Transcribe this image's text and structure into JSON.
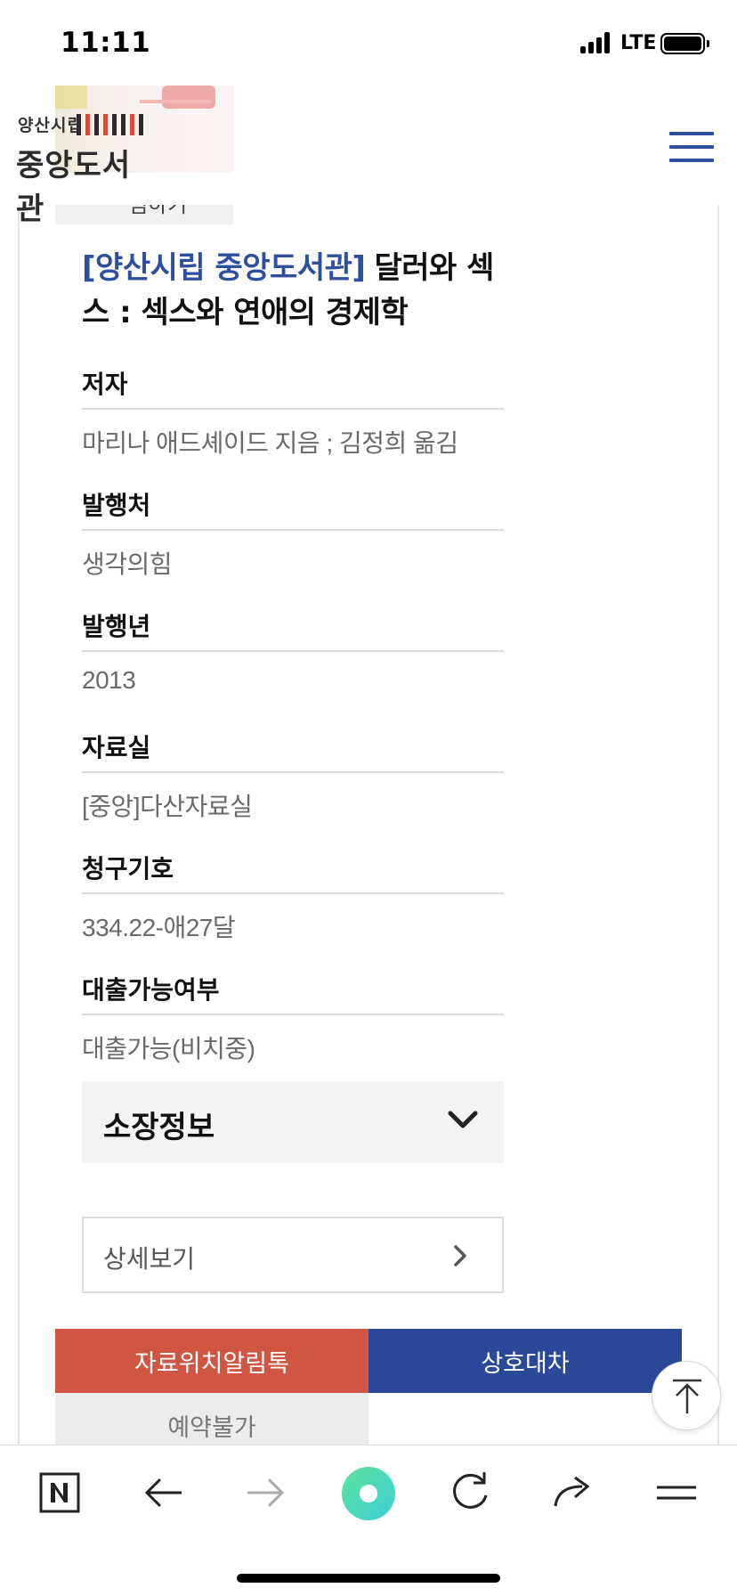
{
  "status_bar": {
    "time": "11:11",
    "network": "LTE"
  },
  "header": {
    "logo_line1": "양산시립",
    "logo_line2": "중앙도서관"
  },
  "wishlist": {
    "label": "찜하기"
  },
  "book": {
    "library_tag": "[양산시립 중앙도서관]",
    "title": "달러와 섹스 : 섹스와 연애의 경제학"
  },
  "fields": [
    {
      "label": "저자",
      "value": "마리나 애드셰이드 지음 ; 김정희 옮김"
    },
    {
      "label": "발행처",
      "value": "생각의힘"
    },
    {
      "label": "발행년",
      "value": "2013"
    },
    {
      "label": "자료실",
      "value": "[중앙]다산자료실"
    },
    {
      "label": "청구기호",
      "value": "334.22-애27달"
    },
    {
      "label": "대출가능여부",
      "value": "대출가능(비치중)"
    }
  ],
  "holdings": {
    "label": "소장정보"
  },
  "detail": {
    "label": "상세보기"
  },
  "actions": {
    "location_alert": "자료위치알림톡",
    "interlibrary_loan": "상호대차",
    "reservation": "예약불가"
  },
  "colors": {
    "brand_blue": "#2d4f9e",
    "action_red": "#cf5642",
    "action_blue": "#2a4a99"
  }
}
